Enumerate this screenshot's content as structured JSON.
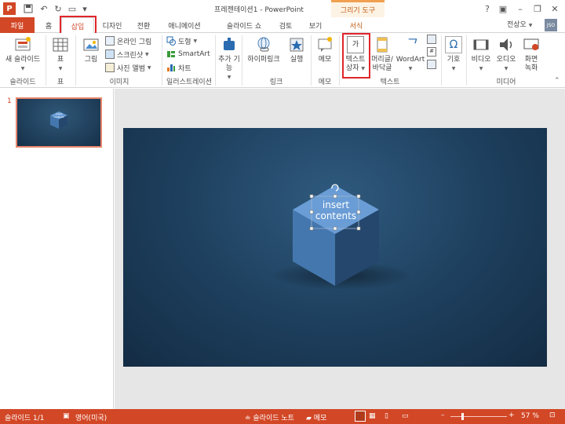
{
  "title_bar": {
    "app_logo": "P",
    "title": "프레젠테이션1 - PowerPoint",
    "context_group": "그리기 도구",
    "controls": {
      "help": "?",
      "minimize": "–",
      "restore": "❐",
      "close": "✕"
    },
    "qat_icons": [
      "save-icon",
      "undo-icon",
      "redo-icon",
      "start-icon",
      "customize-icon"
    ]
  },
  "tabs": {
    "file": "파일",
    "home": "홈",
    "insert": "삽입",
    "design": "디자인",
    "transitions": "전환",
    "animations": "애니메이션",
    "slideshow": "슬라이드 쇼",
    "review": "검토",
    "view": "보기",
    "format": "서식",
    "user": "전상오",
    "user_initials": "JSO",
    "active": "삽입"
  },
  "ribbon": {
    "new_slide": "새 슬라이드",
    "table": "표",
    "picture": "그림",
    "online_picture": "온라인 그림",
    "screenshot": "스크린샷",
    "photo_album": "사진 앨범",
    "shapes": "도형",
    "smartart": "SmartArt",
    "chart": "차트",
    "addins": "추가 기능",
    "hyperlink": "하이퍼링크",
    "action": "실행",
    "comment": "메모",
    "textbox_line1": "텍스트",
    "textbox_line2": "상자",
    "textbox_glyph": "가",
    "header_line1": "머리글/",
    "header_line2": "바닥글",
    "wordart": "WordArt",
    "symbols": "기호",
    "video": "비디오",
    "audio": "오디오",
    "screen_rec_line1": "화면",
    "screen_rec_line2": "녹화",
    "groups": {
      "slides": "슬라이드",
      "tables": "표",
      "images": "이미지",
      "illustrations": "일러스트레이션",
      "links": "링크",
      "comments": "메모",
      "text": "텍스트",
      "media": "미디어"
    }
  },
  "slides_pane": {
    "slide_number": "1",
    "thumb_text": "insert contents"
  },
  "slide": {
    "text_line1": "insert",
    "text_line2": "contents",
    "colors": {
      "cube_top": "#6a9dd6",
      "cube_left": "#4477ad",
      "cube_right": "#25476d"
    }
  },
  "status_bar": {
    "slide_info": "슬라이드 1/1",
    "language": "영어(미국)",
    "notes": "슬라이드 노트",
    "comments": "메모",
    "zoom": "57 %"
  }
}
